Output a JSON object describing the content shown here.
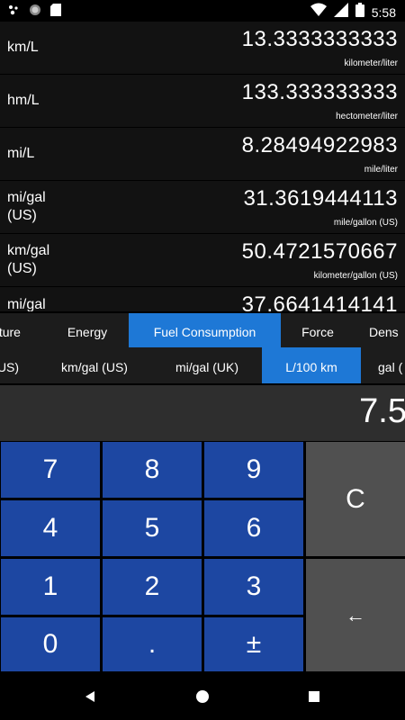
{
  "status_bar": {
    "time": "5:58",
    "icons": [
      "assistant-icon",
      "circle-icon",
      "sd-card-icon",
      "wifi-icon",
      "signal-icon",
      "battery-icon"
    ]
  },
  "results": [
    {
      "unit": "km/L",
      "value": "13.3333333333",
      "description": "kilometer/liter"
    },
    {
      "unit": "hm/L",
      "value": "133.333333333",
      "description": "hectometer/liter"
    },
    {
      "unit": "mi/L",
      "value": "8.28494922983",
      "description": "mile/liter"
    },
    {
      "unit": "mi/gal\n(US)",
      "value": "31.3619444113",
      "description": "mile/gallon (US)"
    },
    {
      "unit": "km/gal\n(US)",
      "value": "50.4721570667",
      "description": "kilometer/gallon (US)"
    },
    {
      "unit": "mi/gal",
      "value": "37.6641414141",
      "description": ""
    }
  ],
  "categories": {
    "items": [
      "ature",
      "Energy",
      "Fuel Consumption",
      "Force",
      "Dens"
    ],
    "active": "Fuel Consumption"
  },
  "units": {
    "items": [
      "US)",
      "km/gal (US)",
      "mi/gal (UK)",
      "L/100 km",
      "gal ("
    ],
    "active": "L/100 km"
  },
  "display": {
    "value": "7.5"
  },
  "keypad": {
    "k7": "7",
    "k8": "8",
    "k9": "9",
    "k4": "4",
    "k5": "5",
    "k6": "6",
    "k1": "1",
    "k2": "2",
    "k3": "3",
    "k0": "0",
    "dot": ".",
    "sign": "±",
    "clear": "C",
    "backspace": "←"
  },
  "colors": {
    "accent": "#1e78d6",
    "key_blue": "#1d47a2",
    "key_gray": "#505050",
    "display_bg": "#2e2e2e"
  }
}
